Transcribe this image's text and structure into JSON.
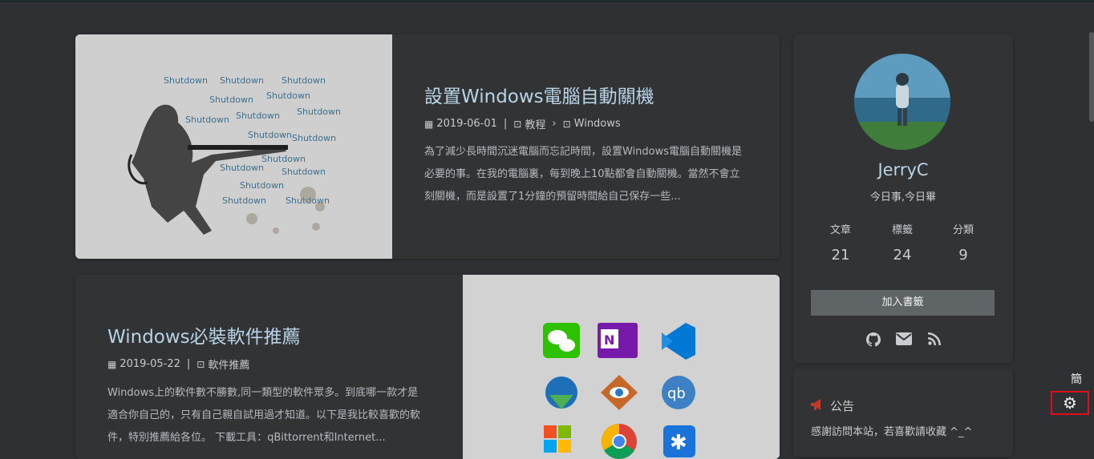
{
  "posts": [
    {
      "title": "設置Windows電腦自動關機",
      "date": "2019-06-01",
      "category": "教程",
      "subcategory": "Windows",
      "excerpt": "為了減少長時間沉迷電腦而忘記時間，設置Windows電腦自動關機是必要的事。在我的電腦裏，每到晚上10點都會自動關機。當然不會立刻關機，而是設置了1分鐘的預留時間給自己保存一些...",
      "thumb_words": [
        "Shutdown",
        "Shutdown",
        "Shutdown",
        "Shutdown",
        "Shutdown",
        "Shutdown",
        "Shutdown",
        "Shutdown",
        "Shutdown",
        "Shutdown",
        "Shutdown",
        "Shutdown",
        "Shutdown",
        "Shutdown",
        "Shutdown",
        "Shutdown"
      ]
    },
    {
      "title": "Windows必裝軟件推薦",
      "date": "2019-05-22",
      "category": "軟件推薦",
      "excerpt": "Windows上的軟件數不勝數,同一類型的軟件眾多。到底哪一款才是適合你自己的，只有自己親自試用過才知道。以下是我比較喜歡的軟件，特別推薦給各位。 下載工具：qBittorrent和Internet..."
    }
  ],
  "profile": {
    "name": "JerryC",
    "motto": "今日事,今日畢",
    "stats": [
      {
        "label": "文章",
        "value": "21"
      },
      {
        "label": "標籤",
        "value": "24"
      },
      {
        "label": "分類",
        "value": "9"
      }
    ],
    "bookmark_label": "加入書籤",
    "social_icons": [
      "github-icon",
      "email-icon",
      "rss-icon"
    ]
  },
  "notice": {
    "title": "公告",
    "text": "感謝訪問本站，若喜歡請收藏 ^_^"
  },
  "tools": {
    "simplified_label": "簡"
  }
}
